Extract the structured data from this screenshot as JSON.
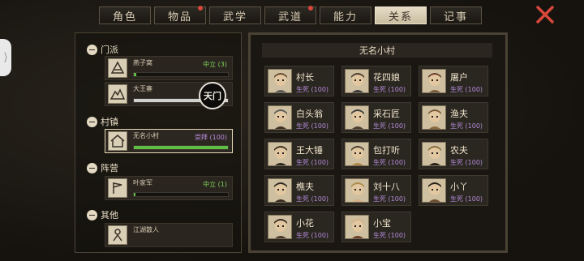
{
  "tabs": [
    {
      "label": "角色",
      "active": false,
      "dot": false
    },
    {
      "label": "物品",
      "active": false,
      "dot": true
    },
    {
      "label": "武学",
      "active": false,
      "dot": false
    },
    {
      "label": "武道",
      "active": false,
      "dot": true
    },
    {
      "label": "能力",
      "active": false,
      "dot": false
    },
    {
      "label": "关系",
      "active": true,
      "dot": false
    },
    {
      "label": "记事",
      "active": false,
      "dot": false
    }
  ],
  "side_handle": "⟩",
  "left": {
    "sections": [
      {
        "title": "门派"
      },
      {
        "title": "村镇"
      },
      {
        "title": "阵营"
      },
      {
        "title": "其他"
      }
    ],
    "factions": [
      {
        "name": "燕子窝",
        "status": "中立 (3)",
        "progress": 0.03,
        "status_color": "#7fd35a",
        "bar_color": "#5fbf45"
      },
      {
        "name": "大王寨",
        "status": "",
        "progress": 1.0,
        "status_color": "#d9d9d9",
        "bar_color": "#cfcfcf"
      },
      {
        "name": "无名小村",
        "status": "崇拜 (100)",
        "progress": 1.0,
        "status_color": "#b98ae0",
        "bar_color": "#5fbf45"
      },
      {
        "name": "叶家军",
        "status": "中立 (1)",
        "progress": 0.02,
        "status_color": "#7fd35a",
        "bar_color": "#5fbf45"
      },
      {
        "name": "江湖散人",
        "status": "",
        "progress": 0,
        "status_color": "#7fd35a",
        "bar_color": "#5fbf45"
      }
    ],
    "stamp_text": "天门"
  },
  "right": {
    "title": "无名小村",
    "npcs": [
      {
        "name": "村长",
        "status": "生死 (100)"
      },
      {
        "name": "花四娘",
        "status": "生死 (100)"
      },
      {
        "name": "屠户",
        "status": "生死 (100)"
      },
      {
        "name": "白头翁",
        "status": "生死 (100)"
      },
      {
        "name": "采石匠",
        "status": "生死 (100)"
      },
      {
        "name": "渔夫",
        "status": "生死 (100)"
      },
      {
        "name": "王大锤",
        "status": "生死 (100)"
      },
      {
        "name": "包打听",
        "status": "生死 (100)"
      },
      {
        "name": "农夫",
        "status": "生死 (100)"
      },
      {
        "name": "樵夫",
        "status": "生死 (100)"
      },
      {
        "name": "刘十八",
        "status": "生死 (100)"
      },
      {
        "name": "小丫",
        "status": "生死 (100)"
      },
      {
        "name": "小花",
        "status": "生死 (100)"
      },
      {
        "name": "小宝",
        "status": "生死 (100)"
      }
    ]
  },
  "colors": {
    "accent_red": "#d7473a",
    "status_purple": "#b48cd9",
    "bar_green": "#5fbf45"
  },
  "icons": {
    "close": "close-x-icon",
    "section_toggle": "minus-circle-icon"
  }
}
